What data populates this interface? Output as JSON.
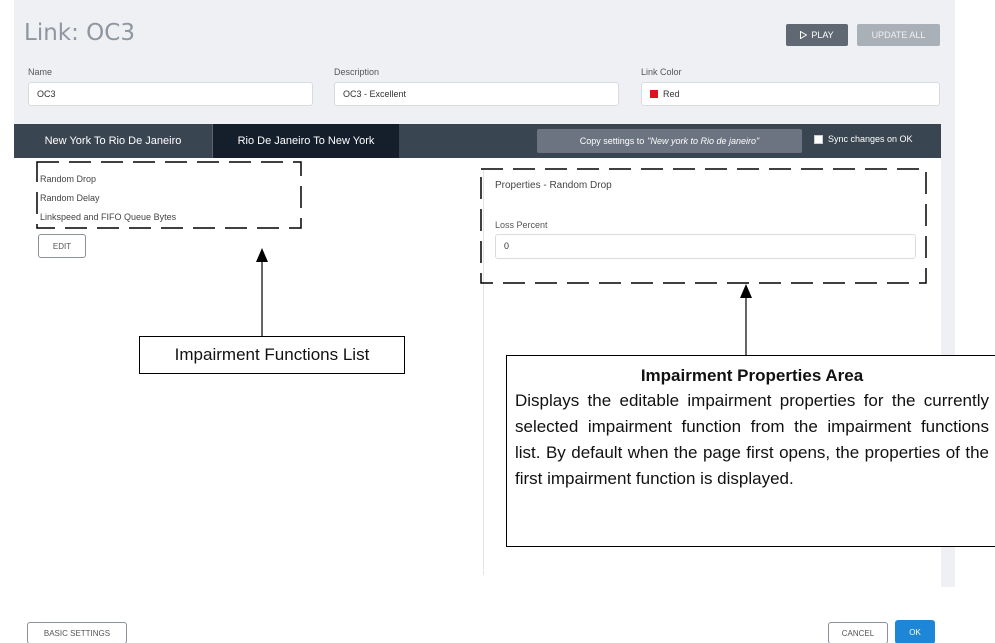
{
  "header": {
    "title": "Link: OC3",
    "play_label": "PLAY",
    "update_all_label": "UPDATE ALL"
  },
  "fields": {
    "name_label": "Name",
    "name_value": "OC3",
    "description_label": "Description",
    "description_value": "OC3 - Excellent",
    "link_color_label": "Link Color",
    "link_color_value": "Red",
    "link_color_hex": "#e0101e"
  },
  "tabs": [
    {
      "label": "New York To Rio De Janeiro",
      "active": false
    },
    {
      "label": "Rio De Janeiro To New York",
      "active": true
    }
  ],
  "toolbar": {
    "copy_prefix": "Copy settings to",
    "copy_target": "\"New york to Rio de janeiro\"",
    "sync_label": "Sync changes on OK"
  },
  "impairments": {
    "items": [
      {
        "label": "Random Drop"
      },
      {
        "label": "Random Delay"
      },
      {
        "label": "Linkspeed and FIFO Queue Bytes"
      }
    ],
    "edit_label": "EDIT"
  },
  "properties": {
    "title": "Properties  - Random Drop",
    "loss_label": "Loss Percent",
    "loss_value": "0"
  },
  "footer": {
    "basic_settings_label": "BASIC SETTINGS",
    "cancel_label": "CANCEL",
    "ok_label": "OK"
  },
  "annotations": {
    "list_callout": "Impairment Functions List",
    "props_callout_title": "Impairment Properties Area",
    "props_callout_body": "Displays the editable impairment properties for the currently selected impairment function from the impairment functions list. By default when the page first opens, the properties of the first impairment function is displayed."
  },
  "colors": {
    "tabbar": "#3a4552",
    "active_tab": "#151f2c",
    "ok_button": "#1d86d6",
    "play_button": "#5f6873"
  }
}
